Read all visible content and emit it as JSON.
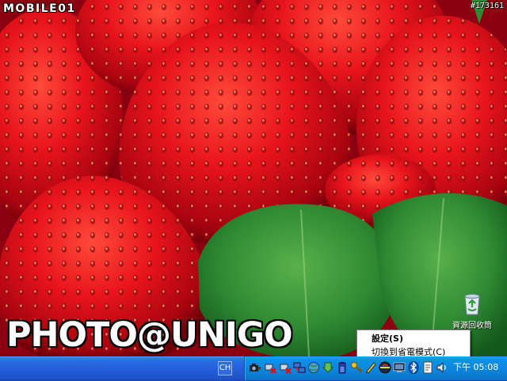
{
  "watermark": {
    "logo_text": "MOBILE01",
    "photo_id": "#173161"
  },
  "photo_credit": "PHOTO@UNIGO",
  "desktop": {
    "icons": [
      {
        "label": "資源回收筒",
        "icon": "recycle-bin-icon"
      }
    ]
  },
  "context_menu": {
    "items": [
      {
        "label": "設定(S)",
        "default": true
      },
      {
        "label": "切換到省電模式(C)",
        "default": false
      }
    ]
  },
  "taskbar": {
    "language_indicator": "CH",
    "tray_icons": [
      "network-camera-icon",
      "network-disconnected-icon",
      "network-disconnected-icon",
      "network-icon",
      "globe-icon",
      "download-icon",
      "battery-icon",
      "key-icon",
      "pen-icon",
      "java-icon",
      "monitor-icon",
      "bluetooth-icon",
      "document-icon",
      "speaker-icon",
      "volume-icon"
    ],
    "clock": "下午 05:08"
  },
  "colors": {
    "taskbar_blue": "#245edb",
    "systray_blue": "#0c84dc",
    "strawberry_red": "#e0121c",
    "leaf_green": "#2f8a33"
  }
}
